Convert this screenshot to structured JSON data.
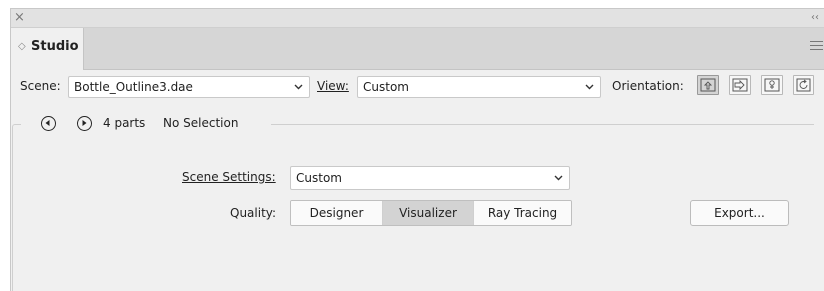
{
  "panel": {
    "close_glyph": "×",
    "collapse_glyph": "‹‹",
    "tab_label": "Studio",
    "tab_icon": "◇"
  },
  "toolbar": {
    "scene_label": "Scene:",
    "scene_value": "Bottle_Outline3.dae",
    "view_label": "View:",
    "view_value": "Custom",
    "orientation_label": "Orientation:",
    "orientation_buttons": [
      "orientation-front-icon",
      "orientation-side-icon",
      "orientation-top-icon",
      "orientation-rotate-icon"
    ]
  },
  "parts": {
    "count_label": "4 parts",
    "selection_label": "No Selection"
  },
  "settings": {
    "scene_settings_label": "Scene Settings:",
    "scene_settings_value": "Custom",
    "quality_label": "Quality:",
    "quality_options": [
      "Designer",
      "Visualizer",
      "Ray Tracing"
    ],
    "quality_selected": "Visualizer",
    "export_label": "Export..."
  },
  "colors": {
    "panel_bg": "#f0f0f0",
    "selected_segment": "#d3d3d3",
    "tab_strip": "#d6d6d6"
  }
}
